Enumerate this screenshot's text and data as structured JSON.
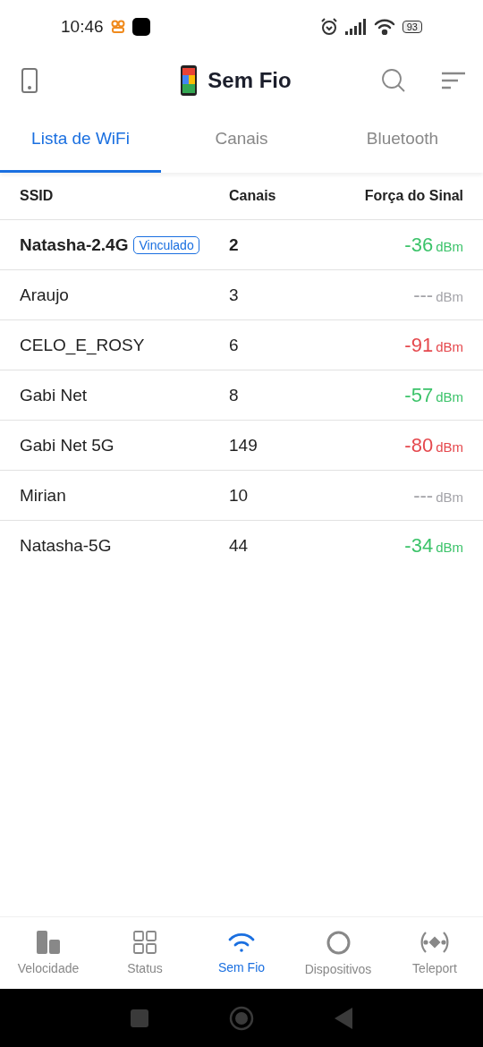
{
  "status_bar": {
    "time": "10:46",
    "battery": "93"
  },
  "header": {
    "title": "Sem Fio"
  },
  "tabs": [
    {
      "label": "Lista de WiFi",
      "selected": true
    },
    {
      "label": "Canais",
      "selected": false
    },
    {
      "label": "Bluetooth",
      "selected": false
    }
  ],
  "table": {
    "columns": [
      "SSID",
      "Canais",
      "Força do Sinal"
    ],
    "rows": [
      {
        "ssid": "Natasha-2.4G",
        "badge": "Vinculado",
        "connected": true,
        "channel": "2",
        "signal": "-36",
        "unit": "dBm",
        "color": "#3cc36a"
      },
      {
        "ssid": "Araujo",
        "connected": false,
        "channel": "3",
        "signal": "---",
        "unit": "dBm",
        "color": "#a3a3a8"
      },
      {
        "ssid": "CELO_E_ROSY",
        "connected": false,
        "channel": "6",
        "signal": "-91",
        "unit": "dBm",
        "color": "#e5484d"
      },
      {
        "ssid": "Gabi Net",
        "connected": false,
        "channel": "8",
        "signal": "-57",
        "unit": "dBm",
        "color": "#3cc36a"
      },
      {
        "ssid": "Gabi Net 5G",
        "connected": false,
        "channel": "149",
        "signal": "-80",
        "unit": "dBm",
        "color": "#e5484d"
      },
      {
        "ssid": "Mirian",
        "connected": false,
        "channel": "10",
        "signal": "---",
        "unit": "dBm",
        "color": "#a3a3a8"
      },
      {
        "ssid": "Natasha-5G",
        "connected": false,
        "channel": "44",
        "signal": "-34",
        "unit": "dBm",
        "color": "#3cc36a"
      }
    ]
  },
  "bottom_nav": [
    {
      "label": "Velocidade",
      "kind": "speed",
      "selected": false
    },
    {
      "label": "Status",
      "kind": "status",
      "selected": false
    },
    {
      "label": "Sem Fio",
      "kind": "wifi",
      "selected": true
    },
    {
      "label": "Dispositivos",
      "kind": "devices",
      "selected": false
    },
    {
      "label": "Teleport",
      "kind": "teleport",
      "selected": false
    }
  ]
}
